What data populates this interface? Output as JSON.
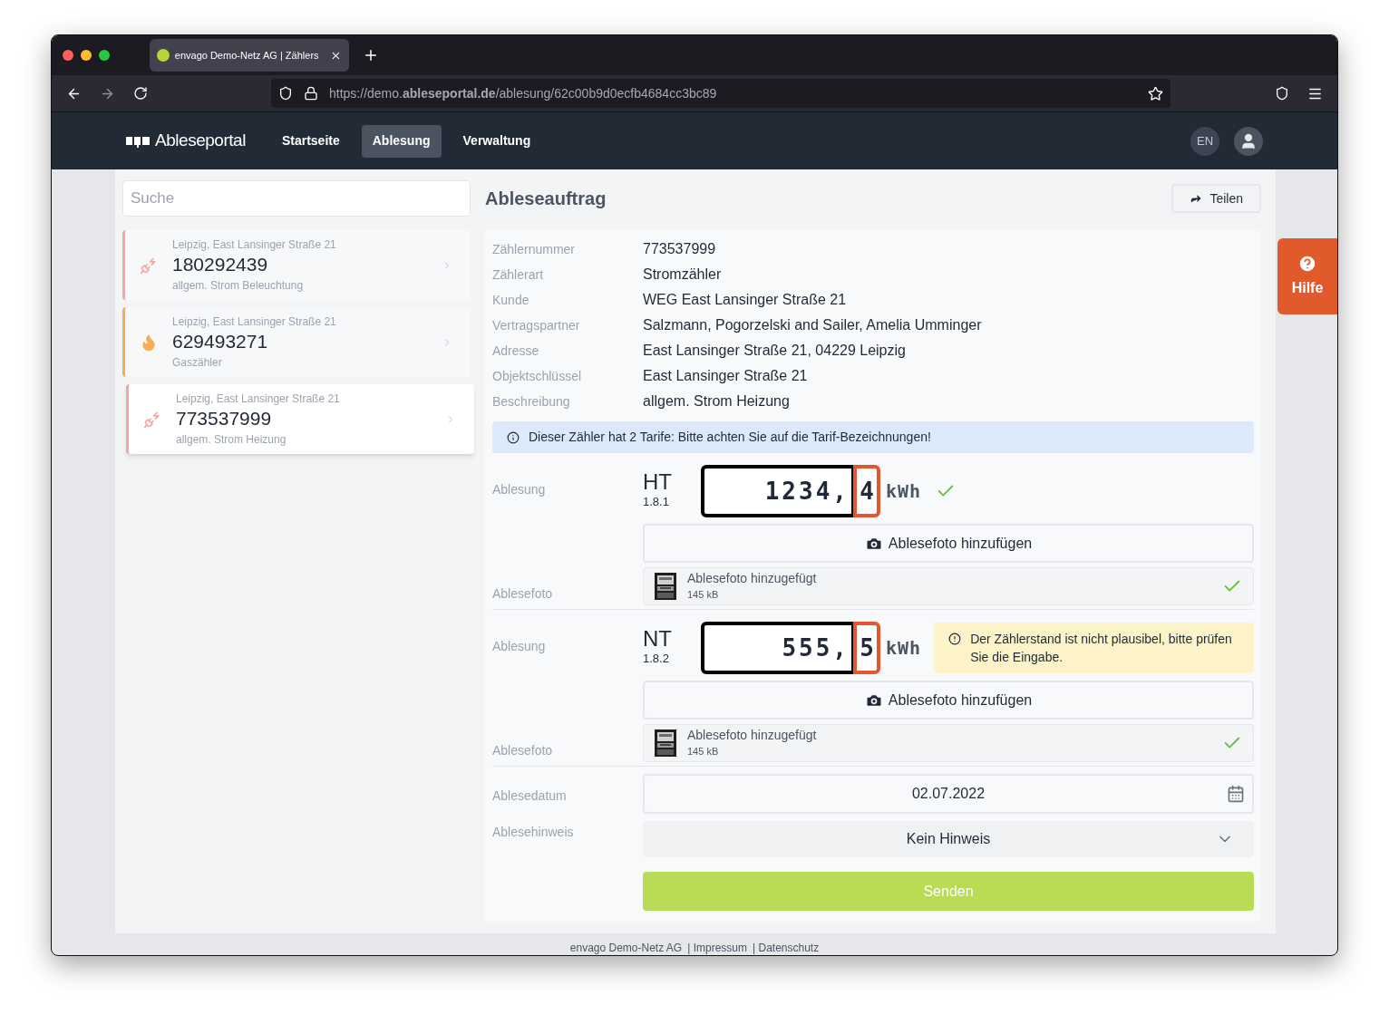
{
  "browser": {
    "tab_title": "envago Demo-Netz AG | Zählers",
    "url": "https://demo.**ableseportal.de**/ablesung/62c00b9d0ecfb4684cc3bc89"
  },
  "navbar": {
    "brand": "Ableseportal",
    "items": [
      {
        "label": "Startseite",
        "selected": false
      },
      {
        "label": "Ablesung",
        "selected": true
      },
      {
        "label": "Verwaltung",
        "selected": false
      }
    ],
    "language": "EN"
  },
  "search": {
    "placeholder": "Suche"
  },
  "meters": [
    {
      "location": "Leipzig, East Lansinger Straße 21",
      "number": "180292439",
      "description": "allgem. Strom Beleuchtung",
      "kind": "power",
      "color": "#f8a5a0",
      "selected": false
    },
    {
      "location": "Leipzig, East Lansinger Straße 21",
      "number": "629493271",
      "description": "Gaszähler",
      "kind": "gas",
      "color": "#f6ad55",
      "selected": false
    },
    {
      "location": "Leipzig, East Lansinger Straße 21",
      "number": "773537999",
      "description": "allgem. Strom Heizung",
      "kind": "power",
      "color": "#f8a5a0",
      "selected": true
    }
  ],
  "order": {
    "title": "Ableseauftrag",
    "share": "Teilen",
    "fields": [
      {
        "label": "Zählernummer",
        "value": "773537999"
      },
      {
        "label": "Zählerart",
        "value": "Stromzähler"
      },
      {
        "label": "Kunde",
        "value": "WEG East Lansinger Straße 21"
      },
      {
        "label": "Vertragspartner",
        "value": "Salzmann, Pogorzelski and Sailer, Amelia Umminger"
      },
      {
        "label": "Adresse",
        "value": "East Lansinger Straße 21, 04229 Leipzig"
      },
      {
        "label": "Objektschlüssel",
        "value": "East Lansinger Straße 21"
      },
      {
        "label": "Beschreibung",
        "value": "allgem. Strom Heizung"
      }
    ],
    "info": "Dieser Zähler hat 2 Tarife: Bitte achten Sie auf die Tarif-Bezeichnungen!",
    "readings": [
      {
        "reading_label": "Ablesung",
        "tariff": "HT",
        "obis": "1.8.1",
        "integer": "1234,",
        "decimal": "4",
        "unit": "kWh",
        "valid": true,
        "photo_button": "Ablesefoto hinzufügen",
        "photo_label": "Ablesefoto",
        "photo_name": "Ablesefoto hinzugefügt",
        "photo_size": "145 kB",
        "photo_ok": true
      },
      {
        "reading_label": "Ablesung",
        "tariff": "NT",
        "obis": "1.8.2",
        "integer": "555,",
        "decimal": "5",
        "unit": "kWh",
        "valid": false,
        "warning": "Der Zählerstand ist nicht plausibel, bitte prüfen Sie die Eingabe.",
        "photo_button": "Ablesefoto hinzufügen",
        "photo_label": "Ablesefoto",
        "photo_name": "Ablesefoto hinzugefügt",
        "photo_size": "145 kB",
        "photo_ok": true
      }
    ],
    "date_label": "Ablesedatum",
    "date": "02.07.2022",
    "hint_label": "Ablesehinweis",
    "hint": "Kein Hinweis",
    "submit": "Senden"
  },
  "help": "Hilfe",
  "footer": [
    "envago Demo-Netz AG",
    "| Impressum",
    "| Datenschutz"
  ]
}
